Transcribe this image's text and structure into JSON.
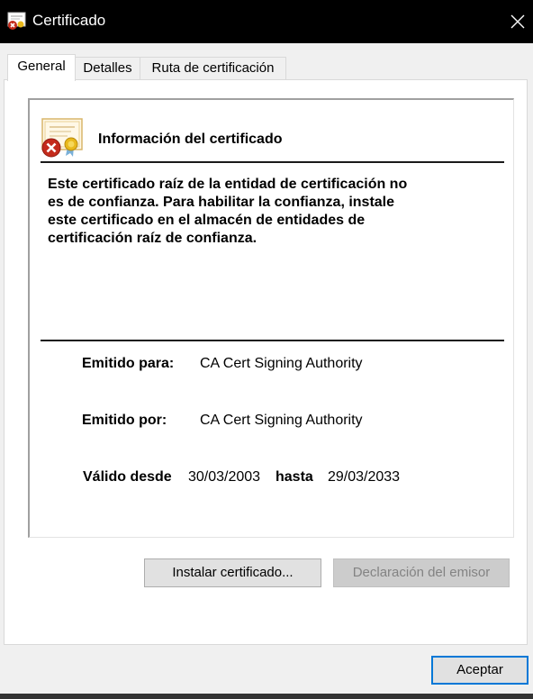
{
  "window": {
    "title": "Certificado",
    "app_icon": "certificate-icon",
    "close_icon": "close-icon"
  },
  "tabs": [
    {
      "label": "General",
      "active": true
    },
    {
      "label": "Detalles",
      "active": false
    },
    {
      "label": "Ruta de certificación",
      "active": false
    }
  ],
  "certificate": {
    "icon": "certificate-error-icon",
    "heading": "Información del certificado",
    "warning_lines": [
      "Este certificado raíz de la entidad de certificación no",
      "es de confianza. Para habilitar la confianza, instale",
      "este certificado en el almacén de entidades de",
      "certificación raíz de confianza."
    ],
    "issued_to_label": "Emitido para:",
    "issued_to_value": "CA Cert Signing Authority",
    "issued_by_label": "Emitido por:",
    "issued_by_value": "CA Cert Signing Authority",
    "valid_from_label": "Válido desde",
    "valid_from_value": "30/03/2003",
    "valid_to_label": "hasta",
    "valid_to_value": "29/03/2033"
  },
  "buttons": {
    "install_label": "Instalar certificado...",
    "issuer_statement_label": "Declaración del emisor",
    "issuer_statement_enabled": false,
    "ok_label": "Aceptar"
  },
  "colors": {
    "titlebar_bg": "#000000",
    "accent": "#0078d7",
    "error_red": "#c42b1c",
    "seal_gold": "#e8b81c"
  }
}
